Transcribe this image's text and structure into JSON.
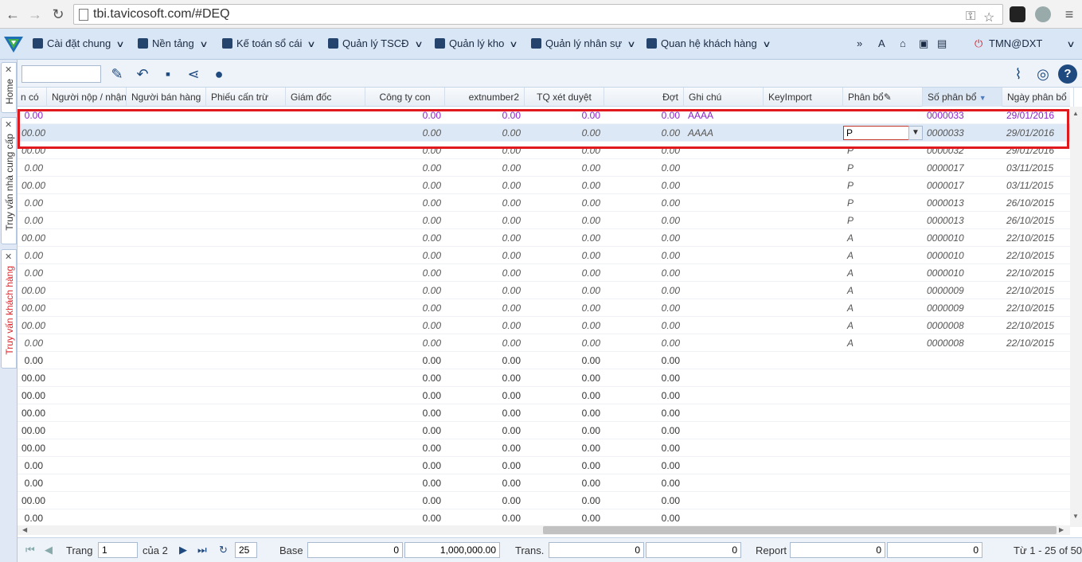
{
  "browser": {
    "url": "tbi.tavicosoft.com/#DEQ"
  },
  "menu": {
    "items": [
      {
        "label": "Cài đặt chung"
      },
      {
        "label": "Nền tảng"
      },
      {
        "label": "Kế toán sổ cái"
      },
      {
        "label": "Quản lý TSCĐ"
      },
      {
        "label": "Quản lý kho"
      },
      {
        "label": "Quản lý nhân sự"
      },
      {
        "label": "Quan hệ khách hàng"
      }
    ],
    "more": "»",
    "font_label": "A",
    "user": "TMN@DXT"
  },
  "sidetabs": {
    "home": "Home",
    "supplier": "Truy vấn nhà cung cấp",
    "customer": "Truy vấn khách hàng"
  },
  "columns": [
    "n có",
    "Người nộp / nhận",
    "Người bán hàng",
    "Phiếu cấn trừ",
    "Giám đốc",
    "Công ty con",
    "extnumber2",
    "TQ xét duyệt",
    "Đợt",
    "Ghi chú",
    "KeyImport",
    "Phân bổ",
    "Số phân bổ",
    "Ngày phân bổ"
  ],
  "sort_indicator": "▼",
  "rows": [
    {
      "a": "0.00",
      "f": "0.00",
      "g": "0.00",
      "h": "0.00",
      "i": "0.00",
      "note": "AAAA",
      "pb": "",
      "so": "0000033",
      "ngay": "29/01/2016"
    },
    {
      "a": "00.00",
      "f": "0.00",
      "g": "0.00",
      "h": "0.00",
      "i": "0.00",
      "note": "AAAA",
      "pb": "P",
      "so": "0000033",
      "ngay": "29/01/2016"
    },
    {
      "a": "00.00",
      "f": "0.00",
      "g": "0.00",
      "h": "0.00",
      "i": "0.00",
      "note": "",
      "pb": "P",
      "so": "0000032",
      "ngay": "29/01/2016"
    },
    {
      "a": "0.00",
      "f": "0.00",
      "g": "0.00",
      "h": "0.00",
      "i": "0.00",
      "note": "",
      "pb": "P",
      "so": "0000017",
      "ngay": "03/11/2015"
    },
    {
      "a": "00.00",
      "f": "0.00",
      "g": "0.00",
      "h": "0.00",
      "i": "0.00",
      "note": "",
      "pb": "P",
      "so": "0000017",
      "ngay": "03/11/2015"
    },
    {
      "a": "0.00",
      "f": "0.00",
      "g": "0.00",
      "h": "0.00",
      "i": "0.00",
      "note": "",
      "pb": "P",
      "so": "0000013",
      "ngay": "26/10/2015"
    },
    {
      "a": "0.00",
      "f": "0.00",
      "g": "0.00",
      "h": "0.00",
      "i": "0.00",
      "note": "",
      "pb": "P",
      "so": "0000013",
      "ngay": "26/10/2015"
    },
    {
      "a": "00.00",
      "f": "0.00",
      "g": "0.00",
      "h": "0.00",
      "i": "0.00",
      "note": "",
      "pb": "A",
      "so": "0000010",
      "ngay": "22/10/2015"
    },
    {
      "a": "0.00",
      "f": "0.00",
      "g": "0.00",
      "h": "0.00",
      "i": "0.00",
      "note": "",
      "pb": "A",
      "so": "0000010",
      "ngay": "22/10/2015"
    },
    {
      "a": "0.00",
      "f": "0.00",
      "g": "0.00",
      "h": "0.00",
      "i": "0.00",
      "note": "",
      "pb": "A",
      "so": "0000010",
      "ngay": "22/10/2015"
    },
    {
      "a": "00.00",
      "f": "0.00",
      "g": "0.00",
      "h": "0.00",
      "i": "0.00",
      "note": "",
      "pb": "A",
      "so": "0000009",
      "ngay": "22/10/2015"
    },
    {
      "a": "00.00",
      "f": "0.00",
      "g": "0.00",
      "h": "0.00",
      "i": "0.00",
      "note": "",
      "pb": "A",
      "so": "0000009",
      "ngay": "22/10/2015"
    },
    {
      "a": "00.00",
      "f": "0.00",
      "g": "0.00",
      "h": "0.00",
      "i": "0.00",
      "note": "",
      "pb": "A",
      "so": "0000008",
      "ngay": "22/10/2015"
    },
    {
      "a": "0.00",
      "f": "0.00",
      "g": "0.00",
      "h": "0.00",
      "i": "0.00",
      "note": "",
      "pb": "A",
      "so": "0000008",
      "ngay": "22/10/2015"
    },
    {
      "a": "0.00",
      "f": "0.00",
      "g": "0.00",
      "h": "0.00",
      "i": "0.00",
      "note": "",
      "pb": "",
      "so": "",
      "ngay": ""
    },
    {
      "a": "00.00",
      "f": "0.00",
      "g": "0.00",
      "h": "0.00",
      "i": "0.00",
      "note": "",
      "pb": "",
      "so": "",
      "ngay": ""
    },
    {
      "a": "00.00",
      "f": "0.00",
      "g": "0.00",
      "h": "0.00",
      "i": "0.00",
      "note": "",
      "pb": "",
      "so": "",
      "ngay": ""
    },
    {
      "a": "00.00",
      "f": "0.00",
      "g": "0.00",
      "h": "0.00",
      "i": "0.00",
      "note": "",
      "pb": "",
      "so": "",
      "ngay": ""
    },
    {
      "a": "00.00",
      "f": "0.00",
      "g": "0.00",
      "h": "0.00",
      "i": "0.00",
      "note": "",
      "pb": "",
      "so": "",
      "ngay": ""
    },
    {
      "a": "00.00",
      "f": "0.00",
      "g": "0.00",
      "h": "0.00",
      "i": "0.00",
      "note": "",
      "pb": "",
      "so": "",
      "ngay": ""
    },
    {
      "a": "0.00",
      "f": "0.00",
      "g": "0.00",
      "h": "0.00",
      "i": "0.00",
      "note": "",
      "pb": "",
      "so": "",
      "ngay": ""
    },
    {
      "a": "0.00",
      "f": "0.00",
      "g": "0.00",
      "h": "0.00",
      "i": "0.00",
      "note": "",
      "pb": "",
      "so": "",
      "ngay": ""
    },
    {
      "a": "00.00",
      "f": "0.00",
      "g": "0.00",
      "h": "0.00",
      "i": "0.00",
      "note": "",
      "pb": "",
      "so": "",
      "ngay": ""
    },
    {
      "a": "0.00",
      "f": "0.00",
      "g": "0.00",
      "h": "0.00",
      "i": "0.00",
      "note": "",
      "pb": "",
      "so": "",
      "ngay": ""
    }
  ],
  "edit_combo_value": "P",
  "pager": {
    "page_label": "Trang",
    "page": "1",
    "of": "của 2",
    "page_size": "25",
    "base_label": "Base",
    "base_1": "0",
    "base_2": "1,000,000.00",
    "trans_label": "Trans.",
    "trans_1": "0",
    "trans_2": "0",
    "report_label": "Report",
    "report_1": "0",
    "report_2": "0",
    "range": "Từ 1 - 25 of 50"
  }
}
